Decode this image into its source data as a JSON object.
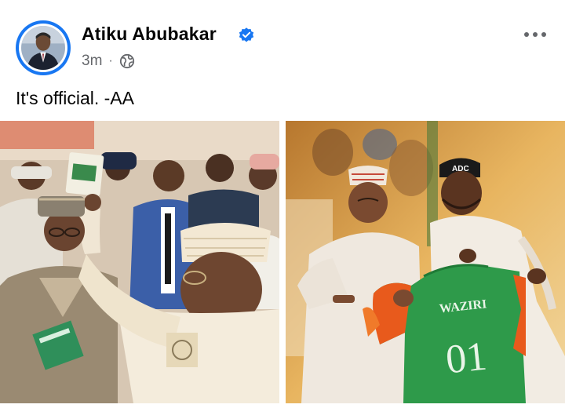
{
  "post": {
    "author": "Atiku Abubakar",
    "verified": true,
    "time": "3m",
    "separator": "·",
    "audience_icon": "globe-icon",
    "more_icon": "more-options-icon",
    "text": "It's official. -AA"
  },
  "photos": [
    {
      "icon": "photo-left",
      "jersey_text": ""
    },
    {
      "icon": "photo-right",
      "jersey_name": "WAZIRI",
      "jersey_number": "01",
      "cap_text": "ADC"
    }
  ],
  "colors": {
    "accent": "#1877f2",
    "meta": "#65676b",
    "jersey_green": "#2e9a4a",
    "jersey_orange": "#e85a1c"
  }
}
